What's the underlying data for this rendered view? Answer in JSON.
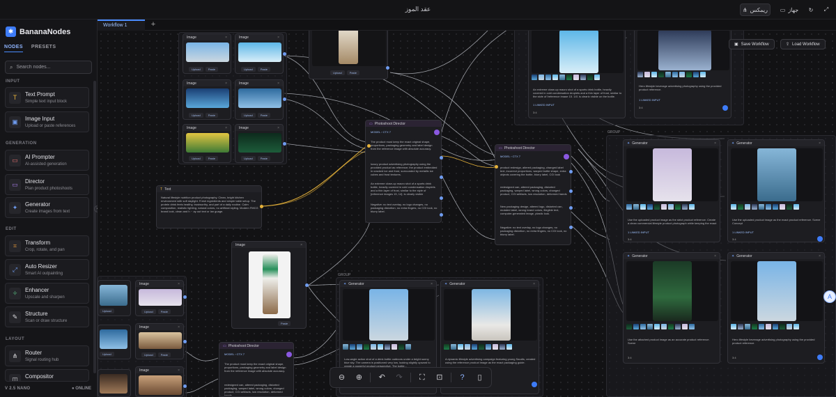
{
  "titlebar": {
    "title": "عقد الموز",
    "remix_label": "ريمكس",
    "device_label": "جهاز"
  },
  "tabs": {
    "active": "Workflow 1",
    "add_label": "+"
  },
  "sidebar": {
    "brand": "BananaNodes",
    "tab_nodes": "NODES",
    "tab_presets": "PRESETS",
    "search_placeholder": "Search nodes...",
    "sections": {
      "input": "INPUT",
      "generation": "GENERATION",
      "edit": "EDIT",
      "layout": "LAYOUT"
    },
    "tools": [
      {
        "name": "Text Prompt",
        "desc": "Simple text input block",
        "icon": "T"
      },
      {
        "name": "Image Input",
        "desc": "Upload or paste references",
        "icon": "▣"
      },
      {
        "name": "AI Prompter",
        "desc": "AI-assisted generation",
        "icon": "▭"
      },
      {
        "name": "Director",
        "desc": "Plan product photoshoots",
        "icon": "▭"
      },
      {
        "name": "Generator",
        "desc": "Create images from text",
        "icon": "✦"
      },
      {
        "name": "Transform",
        "desc": "Crop, rotate, and pan",
        "icon": "⌗"
      },
      {
        "name": "Auto Resizer",
        "desc": "Smart AI outpainting",
        "icon": "⤢"
      },
      {
        "name": "Enhancer",
        "desc": "Upscale and sharpen",
        "icon": "✧"
      },
      {
        "name": "Structure",
        "desc": "Scan or draw structure",
        "icon": "✎"
      },
      {
        "name": "Router",
        "desc": "Signal routing hub",
        "icon": "⋔"
      },
      {
        "name": "Compositor",
        "desc": "",
        "icon": "◫"
      }
    ],
    "footer_version": "V 2.5 NANO",
    "footer_status": "● ONLINE"
  },
  "canvas": {
    "save_workflow": "Save Workflow",
    "load_workflow": "Load Workflow",
    "group_label": "GROUP",
    "node_image": "Image",
    "node_text": "Text",
    "node_director": "Photoshoot Director",
    "node_generator": "Generator",
    "upload": "Upload",
    "paste": "Paste",
    "model_badge": "MODEL ›  CTX 7",
    "linked": "1 LINKED INPUT",
    "aspect": "3:4",
    "text_prompt": "Natural lifestyle nutrition product photography. Clean, bright kitchen environment with soft daylight. Fresh ingredients and simple table setup. The protein drink feels healthy, trustworthy, and part of a daily routine. Calm composition, realistic lighting, natural colors, no artificial styling. Modern FMCG brand look, clean and h  ··  ay out text or lan guage.",
    "gen_prompt_1": "Low-angle action shot of a drink bottle outdoors under a bright sunny blue sky. The camera is positioned very low, looking slightly upward to create a powerful product perspective. The bottle...",
    "gen_prompt_2": "A dynamic lifestyle advertising campaign featuring young Saudis, created using the reference product image as the exact packaging guide.",
    "gen_prompt_3": "Use the uploaded product image as the strict product reference. Create a clean commercial lifestyle product photograph while keeping the exact",
    "gen_prompt_4": "Use the uploaded product image as the exact product reference. Scene Concept",
    "gen_prompt_5": "Use the attached product image as an accurate product reference. Scene",
    "gen_prompt_6": "Hero lifestyle beverage advertising photography using the provided product reference.",
    "gen_prompt_7": "An extreme close-up macro shot of a sports drink bottle, heavily covered in cold condensation droplets and a thin layer of frost, similar to the style of [reference image 15, 14]. is clearly visible on the bottle, looking wet and icy. The bottle is",
    "director_scene": "The product must keep the exact original shape, proportions, packaging geometry and label design from the reference image with absolute accuracy.",
    "director_scene_2": "luxury product advertising photography using the provided product as reference; the product embedded in cracked ice and frost, surrounded by metallic ice cubes and frost textures.",
    "director_scene_3": "An extreme close-up macro shot of a sports drink bottle, heavily covered in cold condensation droplets and a thin layer of frost, similar to the style of [reference images 15, 14]. is clearly visible",
    "director_negative": "Negative: no text overlay, no logo changes, no packaging distortion, no extra fingers, no CGI look, no blurry label.",
    "director_2_scene": "product redesign, altered packaging, changed label text, incorrect proportions, warped bottle shape, extra objects covering the bottle, blurry label, CGI look",
    "director_2_neg": "redesigned can, altered packaging, distorted packaging, warped label, wrong colors, changed product, CGI artifacts, low resolution, deformed hands",
    "director_2_neg2": "New packaging design, altered logo, distorted can, mutated label, wrong brand colors, illegible text, computer-generated image, plastic look.",
    "director_2_neg3": "Negative: no text overlay, no logo changes, no packaging distortion, no extra fingers, no CGI look, no blurry label."
  }
}
